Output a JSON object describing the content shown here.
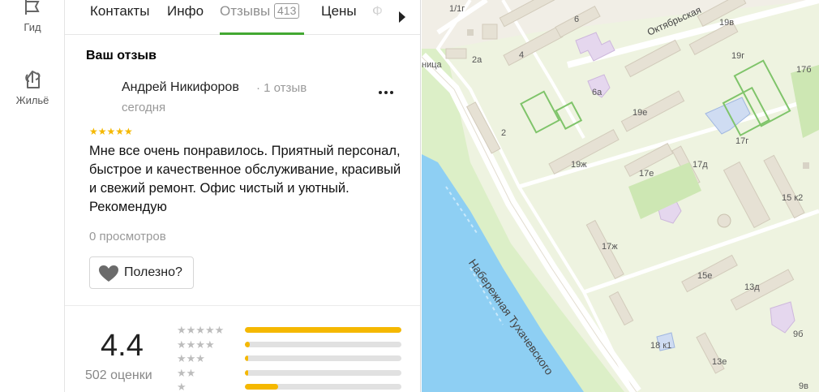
{
  "rail": {
    "items": [
      {
        "label": "Гид",
        "icon": "guide-icon"
      },
      {
        "label": "Жильё",
        "icon": "housing-icon"
      }
    ]
  },
  "tabs": {
    "items": [
      {
        "label": "Контакты"
      },
      {
        "label": "Инфо"
      },
      {
        "label": "Отзывы",
        "count": "413",
        "active": true
      },
      {
        "label": "Цены"
      },
      {
        "label": "Ф"
      }
    ]
  },
  "review": {
    "section_title": "Ваш отзыв",
    "author": "Андрей Никифоров",
    "author_meta": "· 1 отзыв",
    "date": "сегодня",
    "rating_stars": "★★★★★",
    "text": "Мне все очень понравилось. Приятный персонал, быстрое и качественное обслуживание, красивый и свежий ремонт. Офис чистый и уютный. Рекомендую",
    "views": "0 просмотров",
    "useful_label": "Полезно?"
  },
  "rating": {
    "value": "4.4",
    "count_label": "502 оценки",
    "distribution": [
      {
        "stars": "★★★★★",
        "share": 1.0
      },
      {
        "stars": "★★★★",
        "share": 0.03
      },
      {
        "stars": "★★★",
        "share": 0.02
      },
      {
        "stars": "★★",
        "share": 0.02
      },
      {
        "stars": "★",
        "share": 0.21
      }
    ]
  },
  "map": {
    "street_1": "Набережная Тухачевского",
    "street_2": "Октябрьская",
    "labels": [
      "1/1г",
      "6",
      "19в",
      "2а",
      "4",
      "19г",
      "17б",
      "6а",
      "19е",
      "2",
      "17г",
      "19ж",
      "17е",
      "17д",
      "15 к2",
      "17ж",
      "15е",
      "13д",
      "18 к1",
      "13е",
      "9б",
      "9в",
      "ница"
    ],
    "colors": {
      "water": "#8ecff3",
      "park": "#d9ecc0",
      "building": "#e3ddd0",
      "school": "#e5d7ee",
      "accent": "#43a832"
    }
  }
}
